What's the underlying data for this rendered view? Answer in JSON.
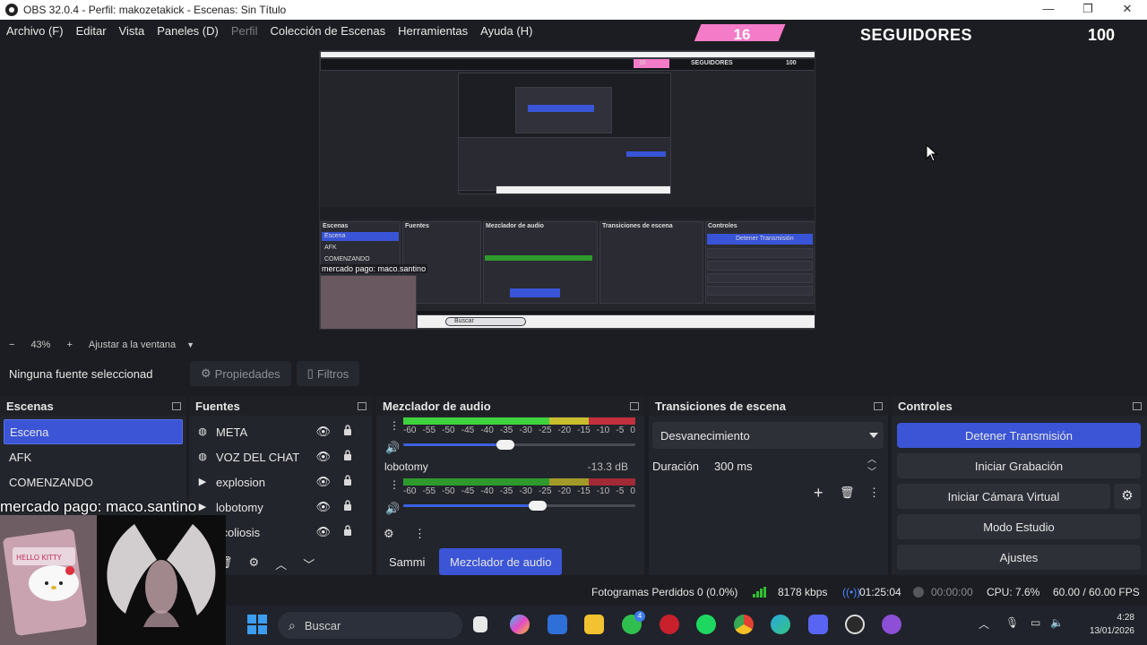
{
  "window": {
    "title": "OBS 32.0.4 - Perfil: makozetakick - Escenas: Sin Título",
    "controls": [
      "—",
      "❐",
      "✕"
    ]
  },
  "menu": {
    "items": [
      "Archivo (F)",
      "Editar",
      "Vista",
      "Paneles (D)",
      "Perfil",
      "Colección de Escenas",
      "Herramientas",
      "Ayuda (H)"
    ]
  },
  "overlay": {
    "count": "16",
    "label": "SEGUIDORES",
    "value": "100"
  },
  "preview": {
    "nested_caption": "mercado pago: maco.santino",
    "nested": {
      "scenes_header": "Escenas",
      "scene_items": [
        "Escena",
        "AFK",
        "COMENZANDO"
      ],
      "sources_header": "Fuentes",
      "mixer_header": "Mezclador de audio",
      "transitions_header": "Transiciones de escena",
      "controls_header": "Controles",
      "stop_label": "Detener Transmisión",
      "overlay_label": "SEGUIDORES",
      "overlay_value": "100",
      "overlay_count": "16",
      "search": "Buscar"
    }
  },
  "zoom": {
    "minus": "−",
    "level": "43%",
    "plus": "+",
    "fit": "Ajustar a la ventana"
  },
  "source_toolbar": {
    "no_selection": "Ninguna fuente seleccionad",
    "properties": "Propiedades",
    "filters": "Filtros"
  },
  "scenes": {
    "title": "Escenas",
    "items": [
      "Escena",
      "AFK",
      "COMENZANDO"
    ]
  },
  "sources": {
    "title": "Fuentes",
    "items": [
      {
        "name": "META",
        "icon": "globe-icon"
      },
      {
        "name": "VOZ DEL CHAT",
        "icon": "globe-icon"
      },
      {
        "name": "explosion",
        "icon": "play-icon"
      },
      {
        "name": "lobotomy",
        "icon": "play-icon"
      },
      {
        "name": "scoliosis",
        "icon": "play-icon"
      }
    ]
  },
  "mixer": {
    "title": "Mezclador de audio",
    "scale": [
      "-60",
      "-55",
      "-50",
      "-45",
      "-40",
      "-35",
      "-30",
      "-25",
      "-20",
      "-15",
      "-10",
      "-5",
      "0"
    ],
    "channels": [
      {
        "name": "",
        "db": "",
        "volume": 0.44
      },
      {
        "name": "lobotomy",
        "db": "-13.3 dB",
        "volume": 0.58
      }
    ],
    "tabs": [
      "Sammi",
      "Mezclador de audio"
    ]
  },
  "transitions": {
    "title": "Transiciones de escena",
    "selected": "Desvanecimiento",
    "duration_label": "Duración",
    "duration_value": "300 ms"
  },
  "controls": {
    "title": "Controles",
    "stop_stream": "Detener Transmisión",
    "start_recording": "Iniciar Grabación",
    "virtual_cam": "Iniciar Cámara Virtual",
    "studio_mode": "Modo Estudio",
    "settings": "Ajustes"
  },
  "status": {
    "dropped": "Fotogramas Perdidos 0 (0.0%)",
    "bitrate": "8178 kbps",
    "stream_time": "01:25:04",
    "rec_time": "00:00:00",
    "cpu": "CPU: 7.6%",
    "fps": "60.00 / 60.00 FPS"
  },
  "webcam": {
    "caption": "mercado pago: maco.santino",
    "sticker_text": "HELLO KITTY"
  },
  "taskbar": {
    "search_placeholder": "Buscar",
    "badge": "4",
    "time": "4:28",
    "date": "13/01/2026"
  },
  "colors": {
    "accent": "#3b55d6",
    "pink": "#f47bc7",
    "panel": "#23252c",
    "background": "#1c1d22"
  }
}
